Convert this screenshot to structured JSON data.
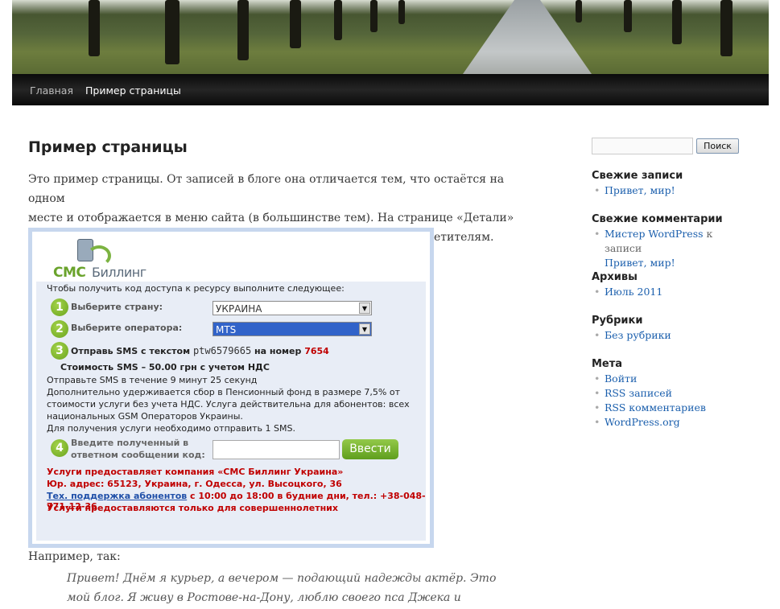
{
  "header": {
    "banner_image": "tree-lined park path photo"
  },
  "nav": {
    "items": [
      "Главная",
      "Пример страницы"
    ]
  },
  "page": {
    "title": "Пример страницы",
    "intro_line1": "Это пример страницы. От записей в блоге она отличается тем, что остаётся на одном",
    "intro_line2": "месте и отображается в меню сайта (в большинстве тем). На странице «Детали»",
    "intro_line3": "владельцы сайтов обычно рассказывают о себе потенциальным посетителям.",
    "after_widget": "Например, так:",
    "quote_line1": "Привет! Днём я курьер, а вечером — подающий надежды актёр. Это",
    "quote_line2": "мой блог. Я живу в Ростове-на-Дону, люблю своего пса Джека и"
  },
  "widget": {
    "logo_sms": "СМС",
    "logo_billing": "Биллинг",
    "instruction": "Чтобы получить код доступа к ресурсу выполните следующее:",
    "step1": {
      "num": "1",
      "label": "Выберите страну:",
      "value": "УКРАИНА"
    },
    "step2": {
      "num": "2",
      "label": "Выберите оператора:",
      "value": "MTS"
    },
    "step3": {
      "num": "3",
      "prefix": "Отправь SMS с текстом",
      "sms_text": "ptw6579665",
      "middle": "на номер",
      "number": "7654"
    },
    "cost": "Стоимость SMS – 50.00 грн с учетом НДС",
    "time_note": "Отправьте SMS в течение 9 минут 25 секунд",
    "fee_note1": "Дополнительно удерживается сбор в Пенсионный фонд в размере 7,5% от",
    "fee_note2": "стоимости услуги без учета НДС. Услуга действительна для абонентов: всех",
    "fee_note3": "национальных GSM Операторов Украины.",
    "count_note": "Для получения услуги необходимо отправить 1 SMS.",
    "step4": {
      "num": "4",
      "label1": "Введите полученный в",
      "label2": "ответном сообщении код:"
    },
    "submit": "Ввести",
    "company": "Услуги предоставляет компания «СМС Биллинг Украина»",
    "address": "Юр. адрес: 65123, Украина, г. Одесса, ул. Высоцкого, 36",
    "support_link": "Тех. поддержка абонентов",
    "support_rest": " с 10:00 до 18:00 в будние дни, тел.: +38-048-771-12-36",
    "adults": "Услуги предоставляются только для совершеннолетних"
  },
  "sidebar": {
    "search_button": "Поиск",
    "recent_posts_title": "Свежие записи",
    "recent_posts": [
      "Привет, мир!"
    ],
    "recent_comments_title": "Свежие комментарии",
    "comment_author": "Мистер WordPress",
    "comment_on": " к записи",
    "comment_post": "Привет, мир!",
    "archives_title": "Архивы",
    "archives": [
      "Июль 2011"
    ],
    "categories_title": "Рубрики",
    "categories": [
      "Без рубрики"
    ],
    "meta_title": "Мета",
    "meta": [
      "Войти",
      "RSS записей",
      "RSS комментариев",
      "WordPress.org"
    ]
  }
}
